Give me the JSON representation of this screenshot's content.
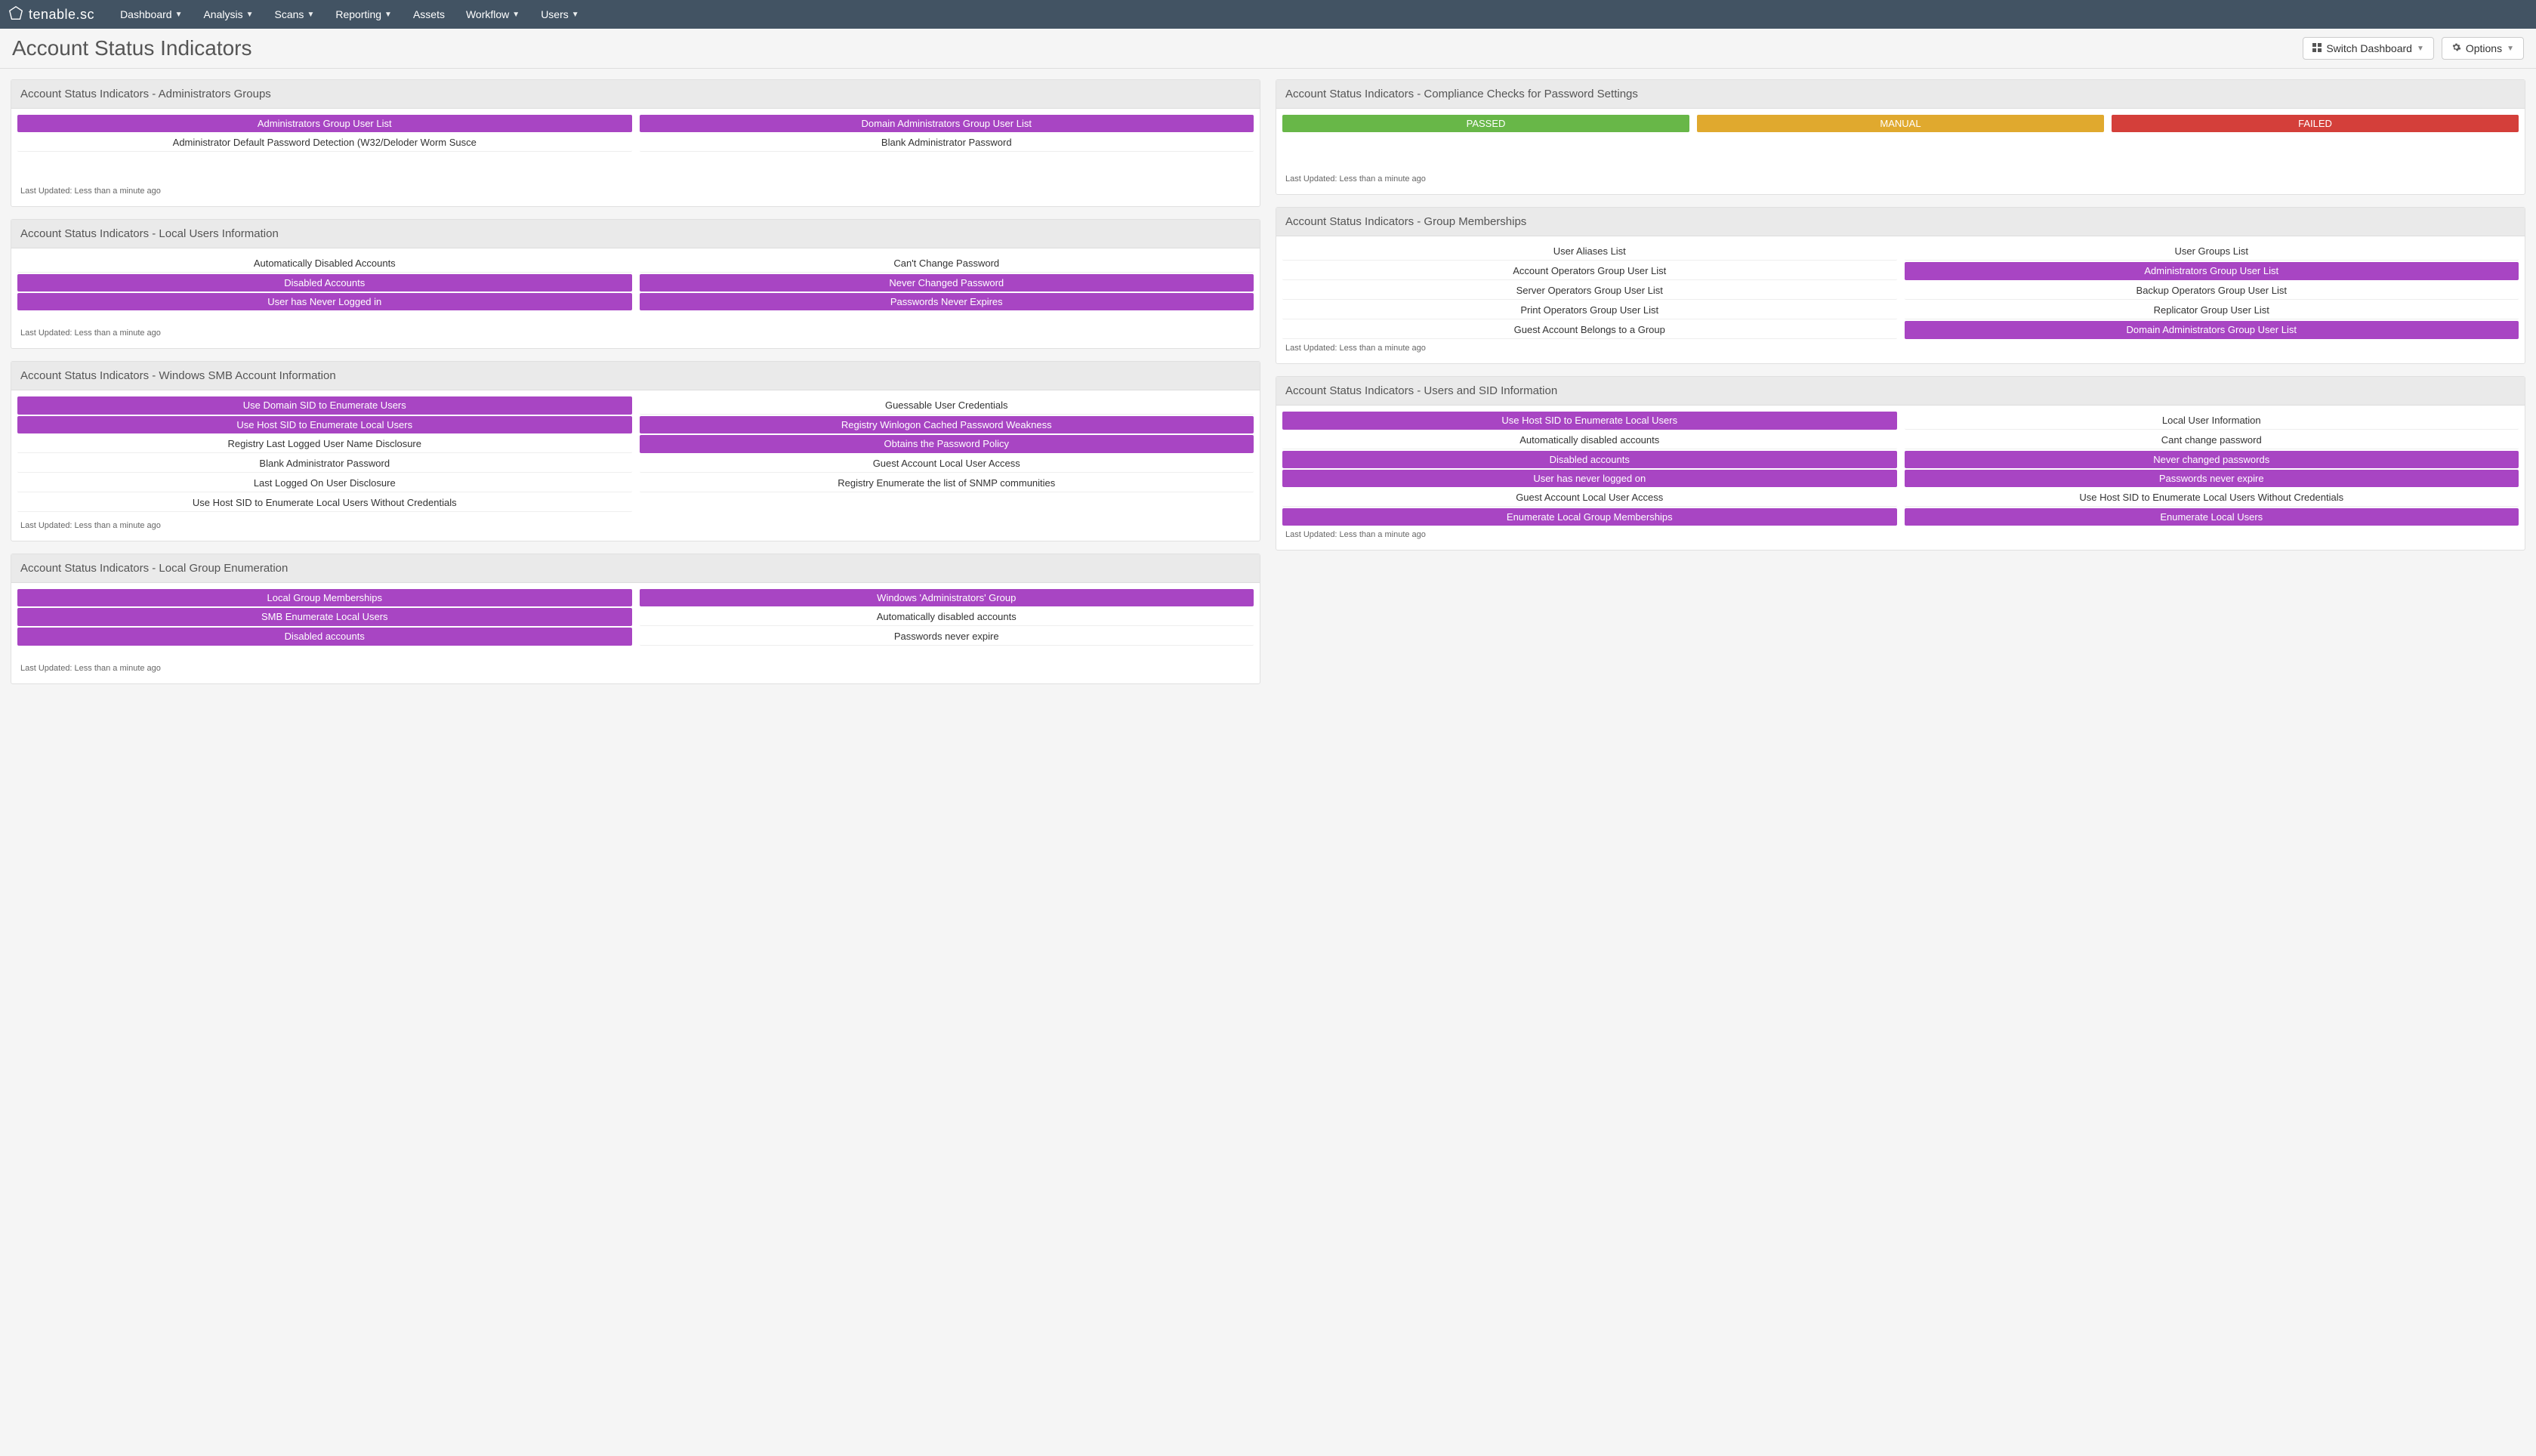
{
  "brand": "tenable.sc",
  "nav": {
    "items": [
      {
        "label": "Dashboard",
        "dropdown": true
      },
      {
        "label": "Analysis",
        "dropdown": true
      },
      {
        "label": "Scans",
        "dropdown": true
      },
      {
        "label": "Reporting",
        "dropdown": true
      },
      {
        "label": "Assets",
        "dropdown": false
      },
      {
        "label": "Workflow",
        "dropdown": true
      },
      {
        "label": "Users",
        "dropdown": true
      }
    ]
  },
  "page": {
    "title": "Account Status Indicators",
    "switch_btn": "Switch Dashboard",
    "options_btn": "Options"
  },
  "footer_text": "Last Updated: Less than a minute ago",
  "panels": {
    "admin_groups": {
      "title": "Account Status Indicators - Administrators Groups",
      "rows": [
        [
          {
            "label": "Administrators Group User List",
            "style": "purple"
          },
          {
            "label": "Domain Administrators Group User List",
            "style": "purple"
          }
        ],
        [
          {
            "label": "Administrator Default Password Detection (W32/Deloder Worm Susce",
            "style": "plain"
          },
          {
            "label": "Blank Administrator Password",
            "style": "plain"
          }
        ]
      ]
    },
    "compliance": {
      "title": "Account Status Indicators - Compliance Checks for Password Settings",
      "row": [
        {
          "label": "PASSED",
          "style": "green"
        },
        {
          "label": "MANUAL",
          "style": "yellow"
        },
        {
          "label": "FAILED",
          "style": "red"
        }
      ]
    },
    "local_users": {
      "title": "Account Status Indicators - Local Users Information",
      "rows": [
        [
          {
            "label": "Automatically Disabled Accounts",
            "style": "plain"
          },
          {
            "label": "Can't Change Password",
            "style": "plain"
          }
        ],
        [
          {
            "label": "Disabled Accounts",
            "style": "purple"
          },
          {
            "label": "Never Changed Password",
            "style": "purple"
          }
        ],
        [
          {
            "label": "User has Never Logged in",
            "style": "purple"
          },
          {
            "label": "Passwords Never Expires",
            "style": "purple"
          }
        ]
      ]
    },
    "group_memberships": {
      "title": "Account Status Indicators - Group Memberships",
      "rows": [
        [
          {
            "label": "User Aliases List",
            "style": "plain"
          },
          {
            "label": "User Groups List",
            "style": "plain"
          }
        ],
        [
          {
            "label": "Account Operators Group User List",
            "style": "plain"
          },
          {
            "label": "Administrators Group User List",
            "style": "purple"
          }
        ],
        [
          {
            "label": "Server Operators Group User List",
            "style": "plain"
          },
          {
            "label": "Backup Operators Group User List",
            "style": "plain"
          }
        ],
        [
          {
            "label": "Print Operators Group User List",
            "style": "plain"
          },
          {
            "label": "Replicator Group User List",
            "style": "plain"
          }
        ],
        [
          {
            "label": "Guest Account Belongs to a Group",
            "style": "plain"
          },
          {
            "label": "Domain Administrators Group User List",
            "style": "purple"
          }
        ]
      ]
    },
    "smb": {
      "title": "Account Status Indicators - Windows SMB Account Information",
      "rows": [
        [
          {
            "label": "Use Domain SID to Enumerate Users",
            "style": "purple"
          },
          {
            "label": "Guessable User Credentials",
            "style": "plain"
          }
        ],
        [
          {
            "label": "Use Host SID to Enumerate Local Users",
            "style": "purple"
          },
          {
            "label": "Registry Winlogon Cached Password Weakness",
            "style": "purple"
          }
        ],
        [
          {
            "label": "Registry Last Logged User Name Disclosure",
            "style": "plain"
          },
          {
            "label": "Obtains the Password Policy",
            "style": "purple"
          }
        ],
        [
          {
            "label": "Blank Administrator Password",
            "style": "plain"
          },
          {
            "label": "Guest Account Local User Access",
            "style": "plain"
          }
        ],
        [
          {
            "label": "Last Logged On User Disclosure",
            "style": "plain"
          },
          {
            "label": "Registry Enumerate the list of SNMP communities",
            "style": "plain"
          }
        ],
        [
          {
            "label": "Use Host SID to Enumerate Local Users Without Credentials",
            "style": "plain"
          },
          {
            "label": "",
            "style": "plain-empty"
          }
        ]
      ]
    },
    "users_sid": {
      "title": "Account Status Indicators - Users and SID Information",
      "rows": [
        [
          {
            "label": "Use Host SID to Enumerate Local Users",
            "style": "purple"
          },
          {
            "label": "Local User Information",
            "style": "plain"
          }
        ],
        [
          {
            "label": "Automatically disabled accounts",
            "style": "plain"
          },
          {
            "label": "Cant change password",
            "style": "plain"
          }
        ],
        [
          {
            "label": "Disabled accounts",
            "style": "purple"
          },
          {
            "label": "Never changed passwords",
            "style": "purple"
          }
        ],
        [
          {
            "label": "User has never logged on",
            "style": "purple"
          },
          {
            "label": "Passwords never expire",
            "style": "purple"
          }
        ],
        [
          {
            "label": "Guest Account Local User Access",
            "style": "plain"
          },
          {
            "label": "Use Host SID to Enumerate Local Users Without Credentials",
            "style": "plain"
          }
        ],
        [
          {
            "label": "Enumerate Local Group Memberships",
            "style": "purple"
          },
          {
            "label": "Enumerate Local Users",
            "style": "purple"
          }
        ]
      ]
    },
    "local_group_enum": {
      "title": "Account Status Indicators - Local Group Enumeration",
      "rows": [
        [
          {
            "label": "Local Group Memberships",
            "style": "purple"
          },
          {
            "label": "Windows 'Administrators' Group",
            "style": "purple"
          }
        ],
        [
          {
            "label": "SMB Enumerate Local Users",
            "style": "purple"
          },
          {
            "label": "Automatically disabled accounts",
            "style": "plain"
          }
        ],
        [
          {
            "label": "Disabled accounts",
            "style": "purple"
          },
          {
            "label": "Passwords never expire",
            "style": "plain"
          }
        ]
      ]
    }
  }
}
